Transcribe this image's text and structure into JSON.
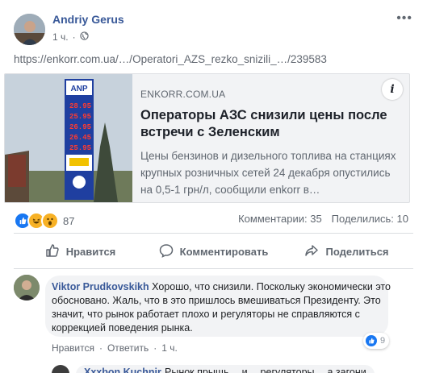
{
  "post": {
    "author": "Andriy Gerus",
    "time": "1 ч.",
    "privacy_icon": "globe-icon",
    "url_text": "https://enkorr.com.ua/…/Operatori_AZS_rezko_snizili_…/239583"
  },
  "link_preview": {
    "domain": "ENKORR.COM.UA",
    "headline": "Операторы АЗС снизили цены после встречи с Зеленским",
    "description": "Цены бензинов и дизельного топлива на станциях крупных розничных сетей 24 декабря опустились на 0,5-1 грн/л, сообщили enkorr в…",
    "info_label": "i",
    "thumbnail": {
      "brand": "ANP",
      "prices": [
        "28.95",
        "25.95",
        "26.95",
        "26.45",
        "25.95"
      ]
    }
  },
  "reactions": {
    "icons": [
      "like-icon",
      "haha-icon",
      "wow-icon"
    ],
    "count": "87",
    "comments": "Комментарии: 35",
    "shares": "Поделились: 10"
  },
  "actions": {
    "like": "Нравится",
    "comment": "Комментировать",
    "share": "Поделиться"
  },
  "comment": {
    "name": "Viktor Prudkovskikh",
    "text": "Хорошо, что снизили. Поскольку экономически это обосновано. Жаль, что в это пришлось вмешиваться Президенту. Это значит, что рынок работает плохо и регуляторы не справляются с коррекцией поведения рынка.",
    "likes": "9",
    "like_action": "Нравится",
    "separator": "·",
    "reply_action": "Ответить",
    "time": "1 ч."
  },
  "reply": {
    "name": "Xxxbon Kuchnir",
    "text": "Рынок прыщь… и… регуляторы… а загони…"
  },
  "colors": {
    "accent": "#385898",
    "like_blue": "#1877f2",
    "haha_yellow": "#f7b125",
    "bubble": "#f2f3f5"
  }
}
